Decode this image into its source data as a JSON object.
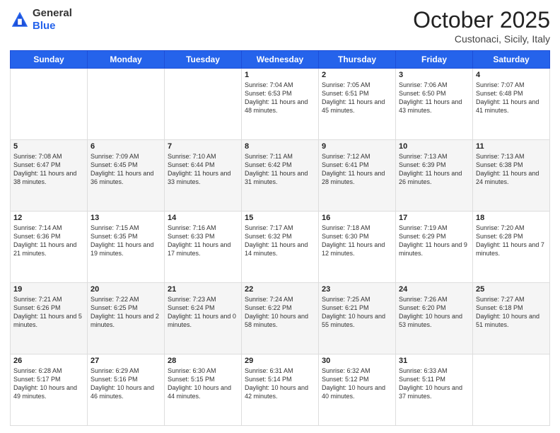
{
  "header": {
    "logo_general": "General",
    "logo_blue": "Blue",
    "month": "October 2025",
    "location": "Custonaci, Sicily, Italy"
  },
  "days_of_week": [
    "Sunday",
    "Monday",
    "Tuesday",
    "Wednesday",
    "Thursday",
    "Friday",
    "Saturday"
  ],
  "weeks": [
    [
      {
        "day": "",
        "info": ""
      },
      {
        "day": "",
        "info": ""
      },
      {
        "day": "",
        "info": ""
      },
      {
        "day": "1",
        "info": "Sunrise: 7:04 AM\nSunset: 6:53 PM\nDaylight: 11 hours\nand 48 minutes."
      },
      {
        "day": "2",
        "info": "Sunrise: 7:05 AM\nSunset: 6:51 PM\nDaylight: 11 hours\nand 45 minutes."
      },
      {
        "day": "3",
        "info": "Sunrise: 7:06 AM\nSunset: 6:50 PM\nDaylight: 11 hours\nand 43 minutes."
      },
      {
        "day": "4",
        "info": "Sunrise: 7:07 AM\nSunset: 6:48 PM\nDaylight: 11 hours\nand 41 minutes."
      }
    ],
    [
      {
        "day": "5",
        "info": "Sunrise: 7:08 AM\nSunset: 6:47 PM\nDaylight: 11 hours\nand 38 minutes."
      },
      {
        "day": "6",
        "info": "Sunrise: 7:09 AM\nSunset: 6:45 PM\nDaylight: 11 hours\nand 36 minutes."
      },
      {
        "day": "7",
        "info": "Sunrise: 7:10 AM\nSunset: 6:44 PM\nDaylight: 11 hours\nand 33 minutes."
      },
      {
        "day": "8",
        "info": "Sunrise: 7:11 AM\nSunset: 6:42 PM\nDaylight: 11 hours\nand 31 minutes."
      },
      {
        "day": "9",
        "info": "Sunrise: 7:12 AM\nSunset: 6:41 PM\nDaylight: 11 hours\nand 28 minutes."
      },
      {
        "day": "10",
        "info": "Sunrise: 7:13 AM\nSunset: 6:39 PM\nDaylight: 11 hours\nand 26 minutes."
      },
      {
        "day": "11",
        "info": "Sunrise: 7:13 AM\nSunset: 6:38 PM\nDaylight: 11 hours\nand 24 minutes."
      }
    ],
    [
      {
        "day": "12",
        "info": "Sunrise: 7:14 AM\nSunset: 6:36 PM\nDaylight: 11 hours\nand 21 minutes."
      },
      {
        "day": "13",
        "info": "Sunrise: 7:15 AM\nSunset: 6:35 PM\nDaylight: 11 hours\nand 19 minutes."
      },
      {
        "day": "14",
        "info": "Sunrise: 7:16 AM\nSunset: 6:33 PM\nDaylight: 11 hours\nand 17 minutes."
      },
      {
        "day": "15",
        "info": "Sunrise: 7:17 AM\nSunset: 6:32 PM\nDaylight: 11 hours\nand 14 minutes."
      },
      {
        "day": "16",
        "info": "Sunrise: 7:18 AM\nSunset: 6:30 PM\nDaylight: 11 hours\nand 12 minutes."
      },
      {
        "day": "17",
        "info": "Sunrise: 7:19 AM\nSunset: 6:29 PM\nDaylight: 11 hours\nand 9 minutes."
      },
      {
        "day": "18",
        "info": "Sunrise: 7:20 AM\nSunset: 6:28 PM\nDaylight: 11 hours\nand 7 minutes."
      }
    ],
    [
      {
        "day": "19",
        "info": "Sunrise: 7:21 AM\nSunset: 6:26 PM\nDaylight: 11 hours\nand 5 minutes."
      },
      {
        "day": "20",
        "info": "Sunrise: 7:22 AM\nSunset: 6:25 PM\nDaylight: 11 hours\nand 2 minutes."
      },
      {
        "day": "21",
        "info": "Sunrise: 7:23 AM\nSunset: 6:24 PM\nDaylight: 11 hours\nand 0 minutes."
      },
      {
        "day": "22",
        "info": "Sunrise: 7:24 AM\nSunset: 6:22 PM\nDaylight: 10 hours\nand 58 minutes."
      },
      {
        "day": "23",
        "info": "Sunrise: 7:25 AM\nSunset: 6:21 PM\nDaylight: 10 hours\nand 55 minutes."
      },
      {
        "day": "24",
        "info": "Sunrise: 7:26 AM\nSunset: 6:20 PM\nDaylight: 10 hours\nand 53 minutes."
      },
      {
        "day": "25",
        "info": "Sunrise: 7:27 AM\nSunset: 6:18 PM\nDaylight: 10 hours\nand 51 minutes."
      }
    ],
    [
      {
        "day": "26",
        "info": "Sunrise: 6:28 AM\nSunset: 5:17 PM\nDaylight: 10 hours\nand 49 minutes."
      },
      {
        "day": "27",
        "info": "Sunrise: 6:29 AM\nSunset: 5:16 PM\nDaylight: 10 hours\nand 46 minutes."
      },
      {
        "day": "28",
        "info": "Sunrise: 6:30 AM\nSunset: 5:15 PM\nDaylight: 10 hours\nand 44 minutes."
      },
      {
        "day": "29",
        "info": "Sunrise: 6:31 AM\nSunset: 5:14 PM\nDaylight: 10 hours\nand 42 minutes."
      },
      {
        "day": "30",
        "info": "Sunrise: 6:32 AM\nSunset: 5:12 PM\nDaylight: 10 hours\nand 40 minutes."
      },
      {
        "day": "31",
        "info": "Sunrise: 6:33 AM\nSunset: 5:11 PM\nDaylight: 10 hours\nand 37 minutes."
      },
      {
        "day": "",
        "info": ""
      }
    ]
  ],
  "alt_rows": [
    false,
    true,
    false,
    true,
    false
  ]
}
